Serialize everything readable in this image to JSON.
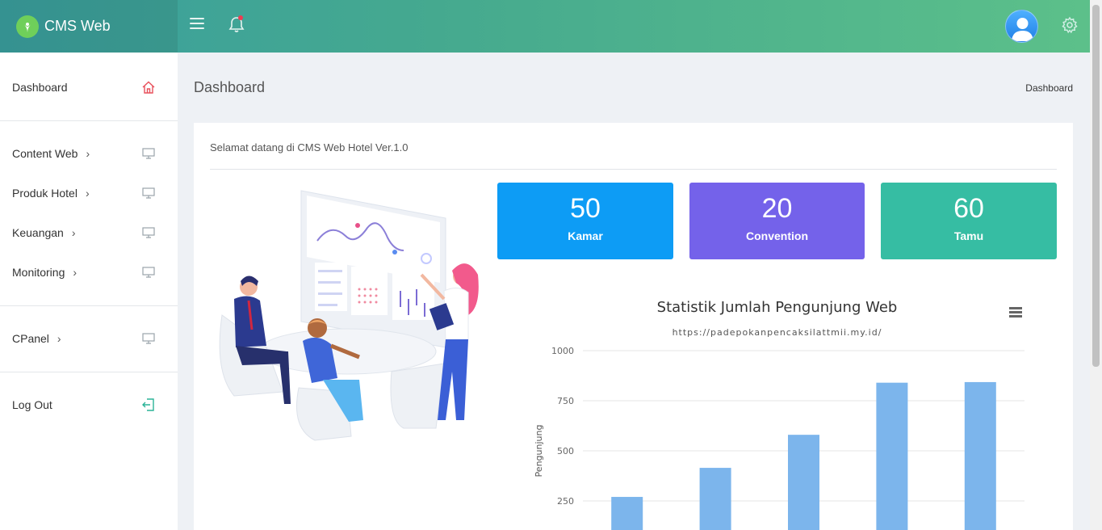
{
  "app": {
    "title": "CMS Web"
  },
  "header": {
    "menu_icon": "hamburger-icon",
    "bell_icon": "bell-icon",
    "avatar_icon": "user-avatar",
    "settings_icon": "gear-icon"
  },
  "sidebar": {
    "items": [
      {
        "label": "Dashboard",
        "icon": "home-icon",
        "chevron": false
      },
      {
        "label": "Content Web",
        "icon": "monitor-icon",
        "chevron": true
      },
      {
        "label": "Produk Hotel",
        "icon": "monitor-icon",
        "chevron": true
      },
      {
        "label": "Keuangan",
        "icon": "monitor-icon",
        "chevron": true
      },
      {
        "label": "Monitoring",
        "icon": "monitor-icon",
        "chevron": true
      },
      {
        "label": "CPanel",
        "icon": "monitor-icon",
        "chevron": true
      },
      {
        "label": "Log Out",
        "icon": "logout-icon",
        "chevron": false
      }
    ],
    "chevron": "›"
  },
  "main": {
    "page_title": "Dashboard",
    "breadcrumb": "Dashboard",
    "welcome": "Selamat datang di CMS Web Hotel Ver.1.0",
    "stats": [
      {
        "value": "50",
        "label": "Kamar",
        "color": "#0d9cf5"
      },
      {
        "value": "20",
        "label": "Convention",
        "color": "#7462ea"
      },
      {
        "value": "60",
        "label": "Tamu",
        "color": "#36bda3"
      }
    ]
  },
  "colors": {
    "accent": "#3aa89b",
    "home_icon": "#e8505b",
    "logout_icon": "#2bb397",
    "bar": "#7cb5ec"
  },
  "chart_data": {
    "type": "bar",
    "title": "Statistik Jumlah Pengunjung Web",
    "subtitle": "https://padepokanpencaksilattmii.my.id/",
    "ylabel": "Pengunjung",
    "xlabel": "",
    "ylim": [
      0,
      1000
    ],
    "yticks": [
      250,
      500,
      750,
      1000
    ],
    "values": [
      270,
      415,
      580,
      840,
      843
    ],
    "grid": true
  }
}
